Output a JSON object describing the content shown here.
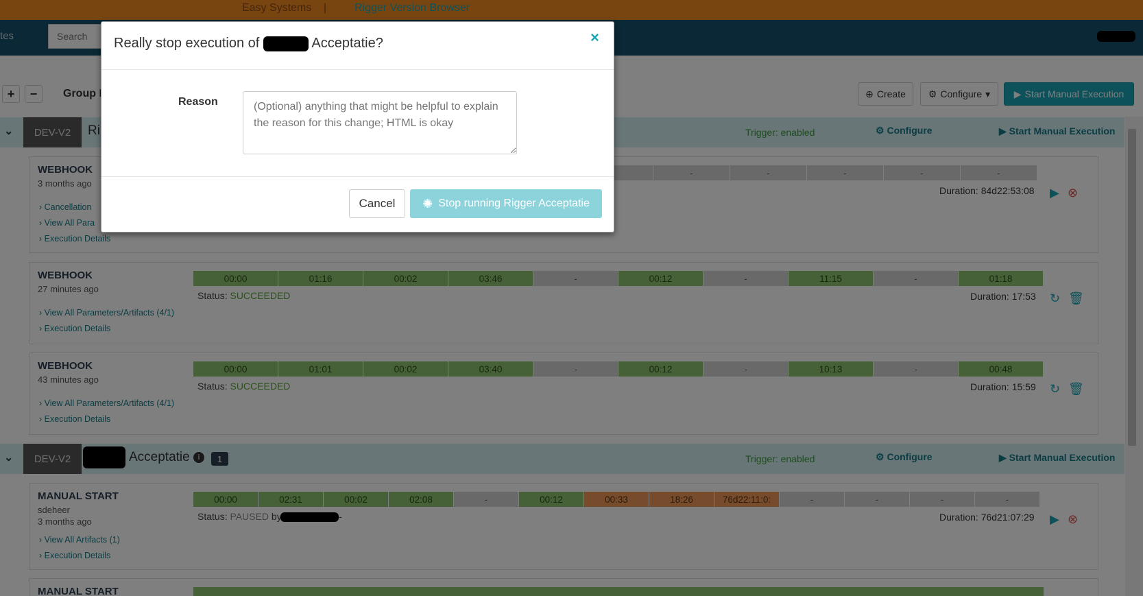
{
  "topbar": {
    "brand": "Easy Systems",
    "separator": "|",
    "app_link": "Rigger Version Browser"
  },
  "navbar": {
    "left_text": "tes",
    "search_placeholder": "Search"
  },
  "actions": {
    "group_label": "Group B",
    "create": "Create",
    "configure": "Configure",
    "start_manual": "Start Manual Execution"
  },
  "groups": [
    {
      "env": "DEV-V2",
      "title": "Ri",
      "trigger": "Trigger: enabled",
      "configure": "Configure",
      "start_manual": "Start Manual Execution"
    },
    {
      "env": "DEV-V2",
      "title": "Acceptatie",
      "count": "1",
      "trigger": "Trigger: enabled",
      "configure": "Configure",
      "start_manual": "Start Manual Execution"
    }
  ],
  "executions": [
    {
      "title": "WEBHOOK",
      "time_ago": "3 months ago",
      "links": [
        "Cancellation",
        "View All Para",
        "Execution Details"
      ],
      "stages": [
        "",
        "-",
        "-",
        "-",
        "-",
        "-"
      ],
      "duration": "Duration: 84d22:53:08"
    },
    {
      "title": "WEBHOOK",
      "time_ago": "27 minutes ago",
      "status_label": "Status:",
      "status": "SUCCEEDED",
      "links": [
        "View All Parameters/Artifacts (4/1)",
        "Execution Details"
      ],
      "stages": [
        "00:00",
        "01:16",
        "00:02",
        "03:46",
        "-",
        "00:12",
        "-",
        "11:15",
        "-",
        "01:18"
      ],
      "duration": "Duration: 17:53"
    },
    {
      "title": "WEBHOOK",
      "time_ago": "43 minutes ago",
      "status_label": "Status:",
      "status": "SUCCEEDED",
      "links": [
        "View All Parameters/Artifacts (4/1)",
        "Execution Details"
      ],
      "stages": [
        "00:00",
        "01:01",
        "00:02",
        "03:40",
        "-",
        "00:12",
        "-",
        "10:13",
        "-",
        "00:48"
      ],
      "duration": "Duration: 15:59"
    },
    {
      "title": "MANUAL START",
      "user": "sdeheer",
      "time_ago": "3 months ago",
      "status_label": "Status:",
      "status": "PAUSED",
      "status_by": "by",
      "status_tail": "-",
      "links": [
        "View All Artifacts (1)",
        "Execution Details"
      ],
      "stages": [
        "00:00",
        "02:31",
        "00:02",
        "02:08",
        "-",
        "00:12",
        "00:33",
        "18:26",
        "76d22:11:0:",
        "-",
        "-",
        "-",
        "-"
      ],
      "duration": "Duration: 76d21:07:29"
    },
    {
      "title": "MANUAL START"
    }
  ],
  "modal": {
    "title_prefix": "Really stop execution of",
    "title_suffix": "Acceptatie?",
    "close_symbol": "×",
    "reason_label": "Reason",
    "reason_placeholder": "(Optional) anything that might be helpful to explain the reason for this change; HTML is okay",
    "cancel": "Cancel",
    "stop": "Stop running Rigger Acceptatie"
  }
}
